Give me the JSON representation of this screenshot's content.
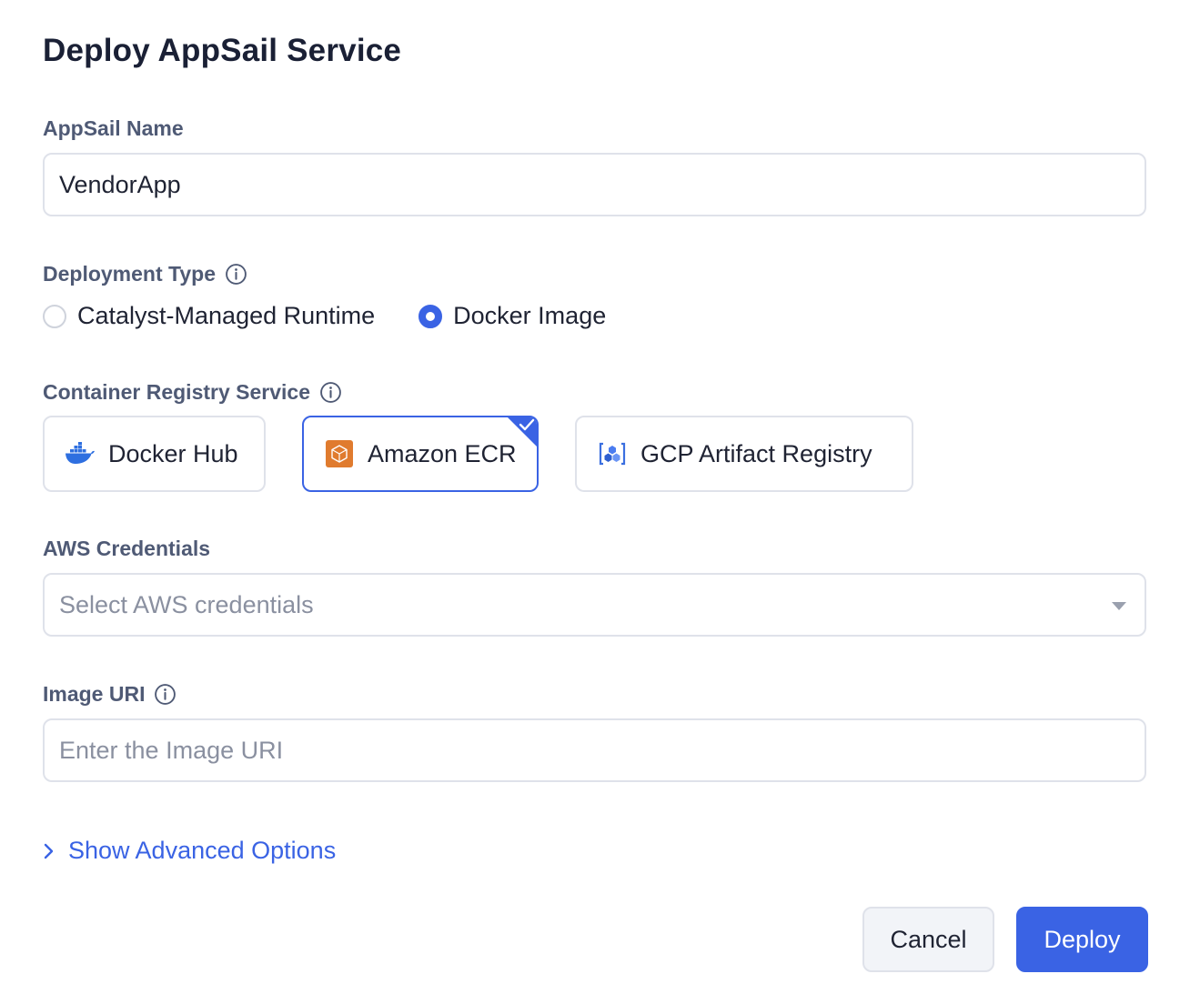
{
  "dialog": {
    "title": "Deploy AppSail Service"
  },
  "appsail_name": {
    "label": "AppSail Name",
    "value": "VendorApp"
  },
  "deployment_type": {
    "label": "Deployment Type",
    "options": [
      {
        "label": "Catalyst-Managed Runtime",
        "selected": false
      },
      {
        "label": "Docker Image",
        "selected": true
      }
    ]
  },
  "registry": {
    "label": "Container Registry Service",
    "options": [
      {
        "label": "Docker Hub",
        "icon": "docker-whale-icon",
        "selected": false
      },
      {
        "label": "Amazon ECR",
        "icon": "aws-ecr-icon",
        "selected": true
      },
      {
        "label": "GCP Artifact Registry",
        "icon": "gcp-artifact-registry-icon",
        "selected": false
      }
    ]
  },
  "aws_credentials": {
    "label": "AWS Credentials",
    "placeholder": "Select AWS credentials"
  },
  "image_uri": {
    "label": "Image URI",
    "placeholder": "Enter the Image URI"
  },
  "advanced": {
    "label": "Show Advanced Options"
  },
  "actions": {
    "cancel_label": "Cancel",
    "deploy_label": "Deploy"
  },
  "colors": {
    "accent": "#3a63e4",
    "label_text": "#4f5a75",
    "border": "#dfe2ea",
    "ecr_orange": "#e07b2e"
  }
}
